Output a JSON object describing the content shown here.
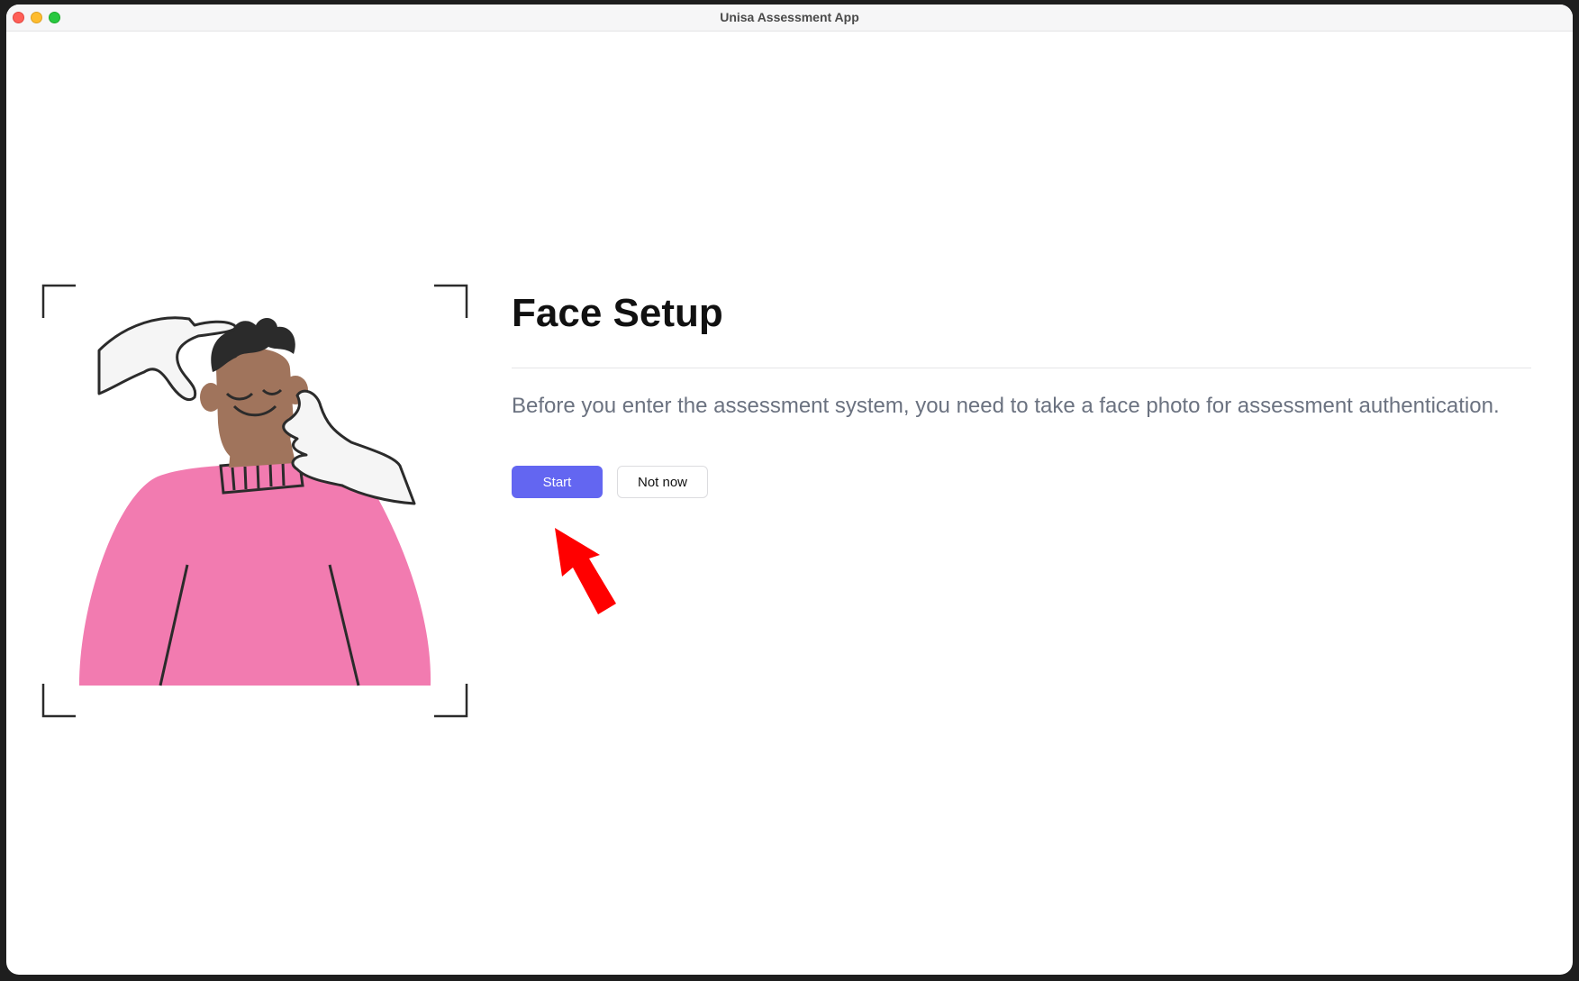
{
  "window": {
    "title": "Unisa Assessment App"
  },
  "main": {
    "heading": "Face Setup",
    "description": "Before you enter the assessment system, you need to take a face photo for assessment authentication.",
    "start_label": "Start",
    "not_now_label": "Not now"
  },
  "colors": {
    "primary": "#6366f1",
    "sweater": "#f27bb0",
    "skin": "#a0745c",
    "arrow": "#ff0000"
  },
  "icons": {
    "illustration": "face-setup-illustration",
    "pointer": "red-arrow-icon"
  }
}
